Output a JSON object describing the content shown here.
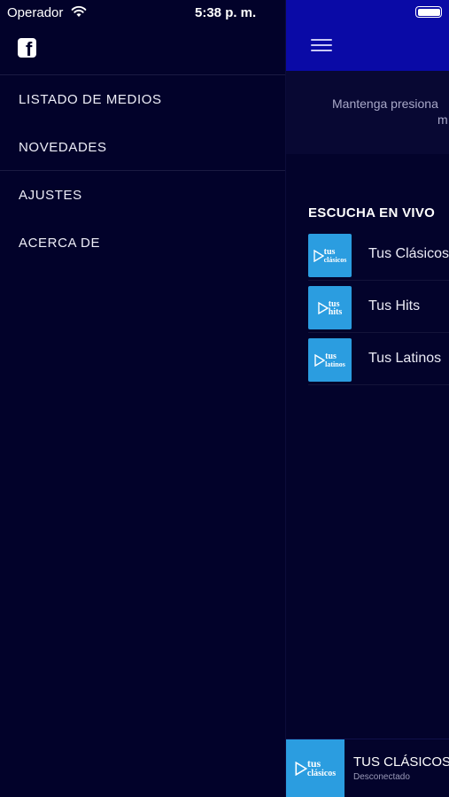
{
  "status_bar": {
    "carrier": "Operador",
    "time": "5:38 p. m."
  },
  "drawer": {
    "facebook_icon": "facebook-icon",
    "items": [
      {
        "label": "LISTADO DE MEDIOS"
      },
      {
        "label": "NOVEDADES"
      },
      {
        "label": "AJUSTES"
      },
      {
        "label": "ACERCA DE"
      }
    ]
  },
  "main": {
    "hint_line1": "Mantenga presiona",
    "hint_line2": "m",
    "section_title": "ESCUCHA EN VIVO",
    "stations": [
      {
        "name": "Tus Clásicos",
        "logo_top": "tus",
        "logo_bottom": "clásicos"
      },
      {
        "name": "Tus Hits",
        "logo_top": "tus",
        "logo_bottom": "hits"
      },
      {
        "name": "Tus Latinos",
        "logo_top": "tus",
        "logo_bottom": "latinos"
      }
    ]
  },
  "player": {
    "title": "TUS CLÁSICOS",
    "status": "Desconectado",
    "logo_top": "tus",
    "logo_bottom": "clásicos"
  },
  "colors": {
    "background": "#02022a",
    "top_bar": "#0a0aa6",
    "logo_blue": "#2b9de0"
  }
}
